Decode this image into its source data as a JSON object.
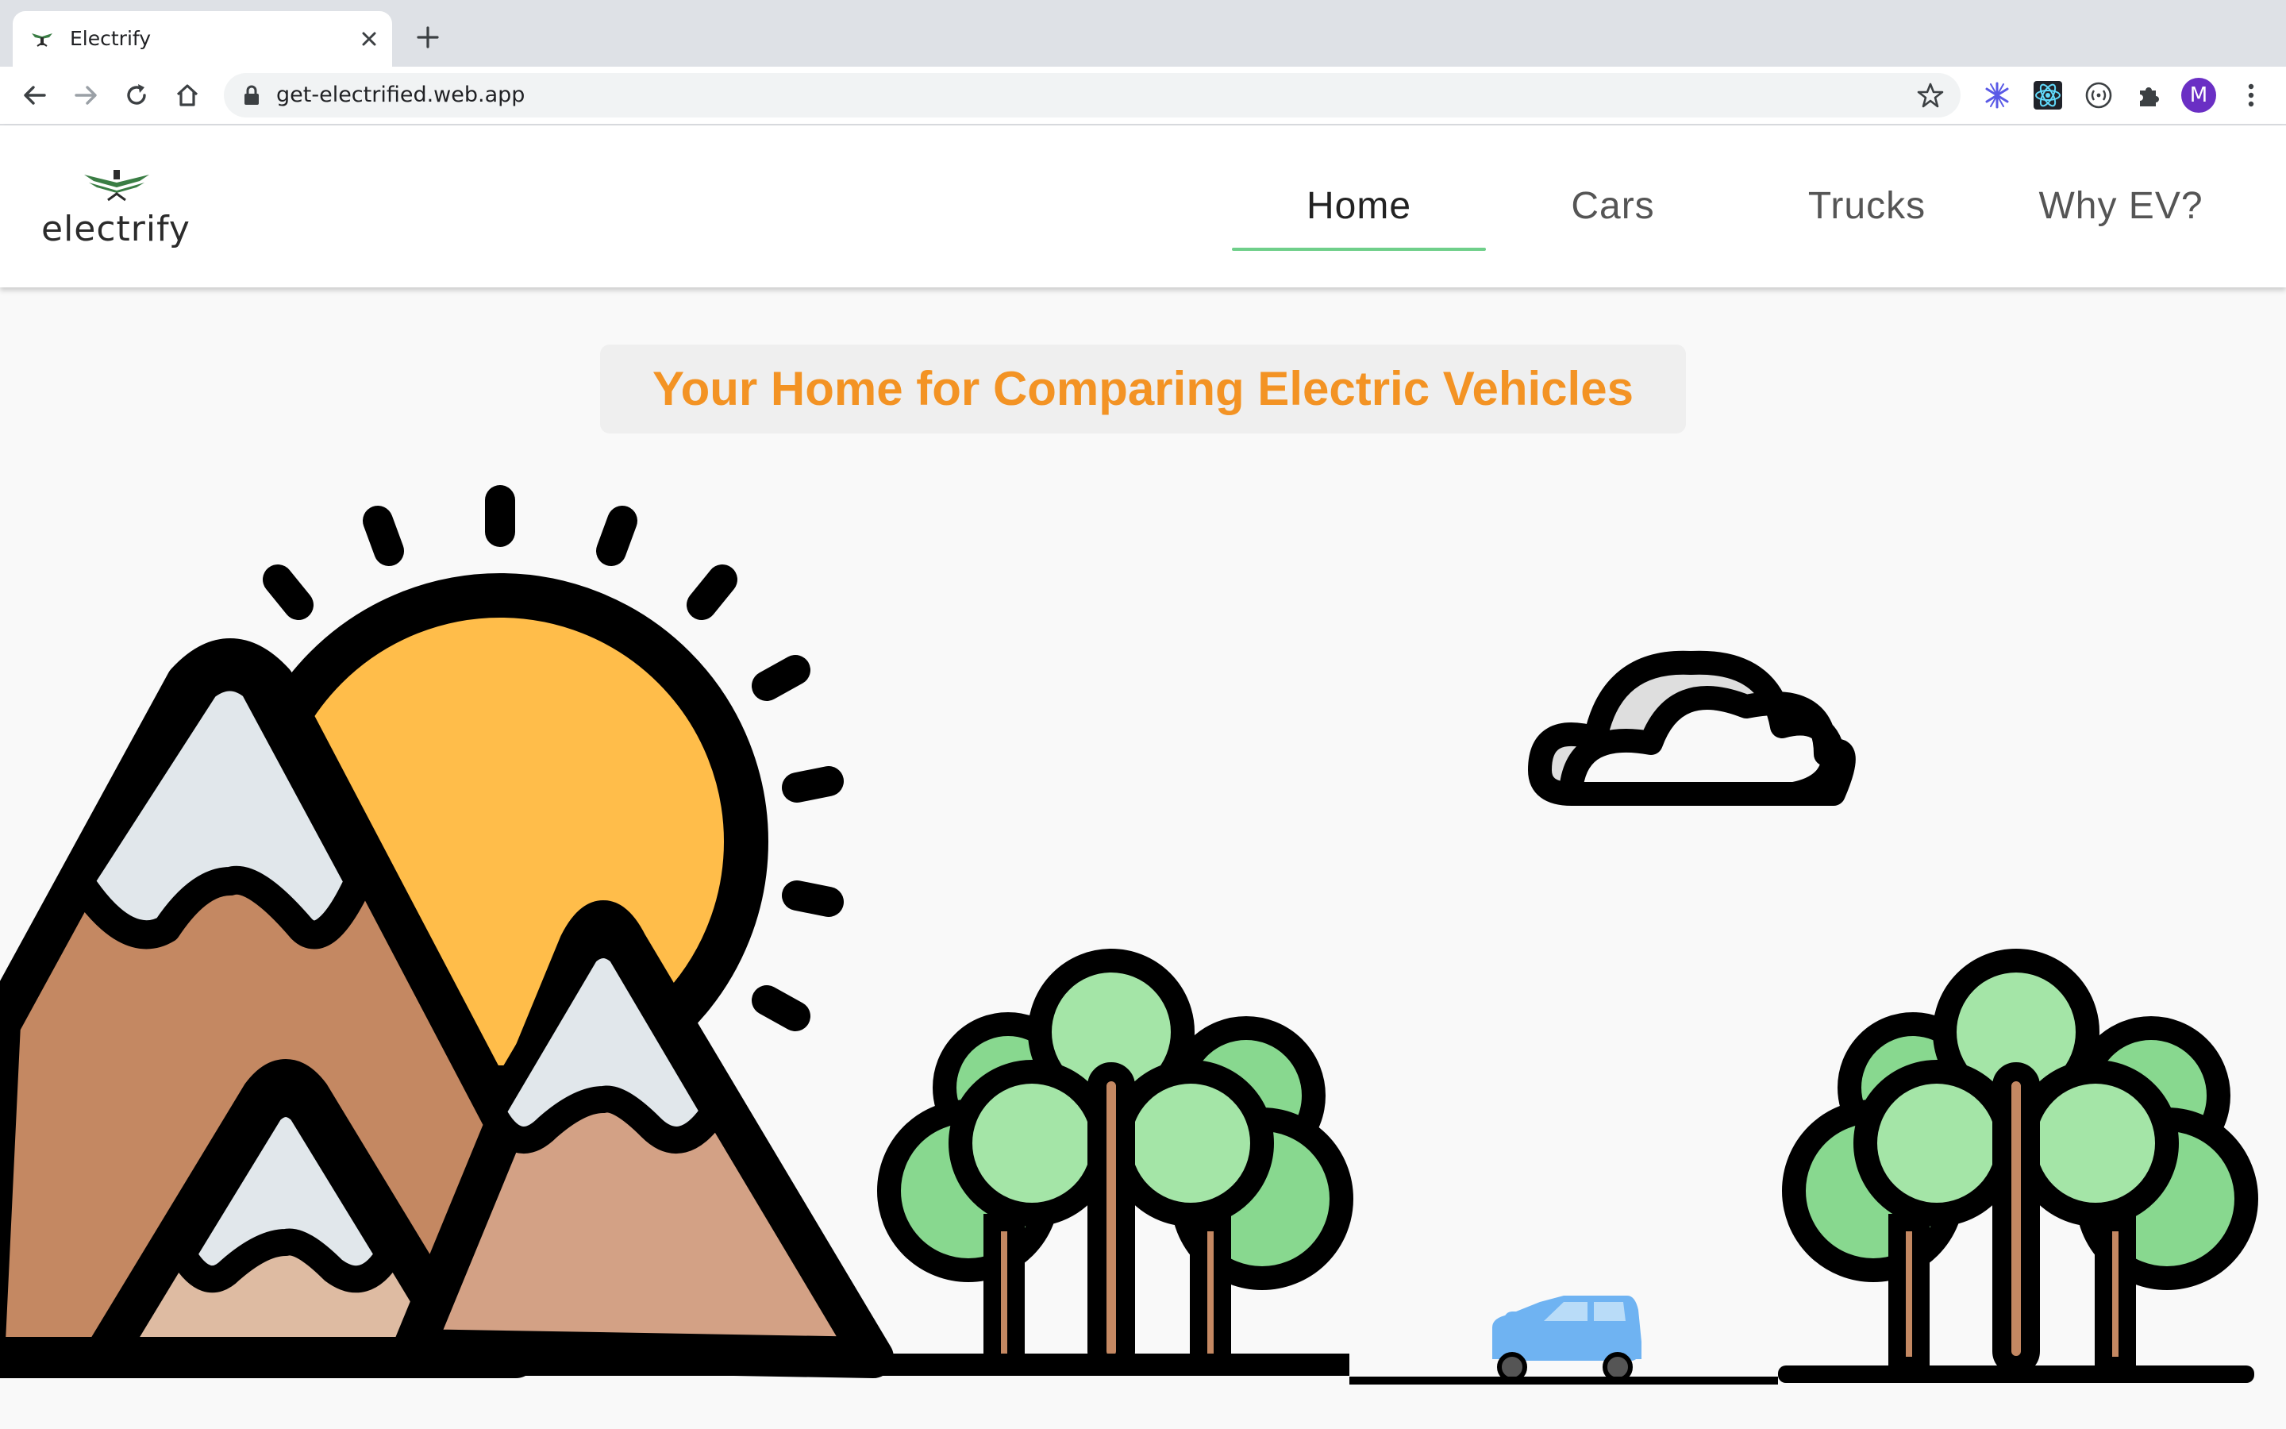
{
  "browser": {
    "tab_title": "Electrify",
    "url": "get-electrified.web.app",
    "favicon": "electrify-logo-icon",
    "toolbar_icons": [
      "back-arrow-icon",
      "forward-arrow-icon",
      "reload-icon",
      "home-icon",
      "lock-icon",
      "bookmark-star-icon",
      "snowflake-extension-icon",
      "react-devtools-icon",
      "redux-devtools-icon",
      "extensions-puzzle-icon",
      "profile-avatar",
      "menu-kebab-icon"
    ],
    "profile_initial": "M"
  },
  "site": {
    "logo_text": "electrify",
    "nav": [
      {
        "label": "Home",
        "active": true
      },
      {
        "label": "Cars",
        "active": false
      },
      {
        "label": "Trucks",
        "active": false
      },
      {
        "label": "Why EV?",
        "active": false
      }
    ],
    "headline": "Your Home for Comparing Electric Vehicles"
  },
  "colors": {
    "accent_orange": "#f39324",
    "nav_underline": "#6fcf8a",
    "profile_purple": "#6a2fc4"
  }
}
